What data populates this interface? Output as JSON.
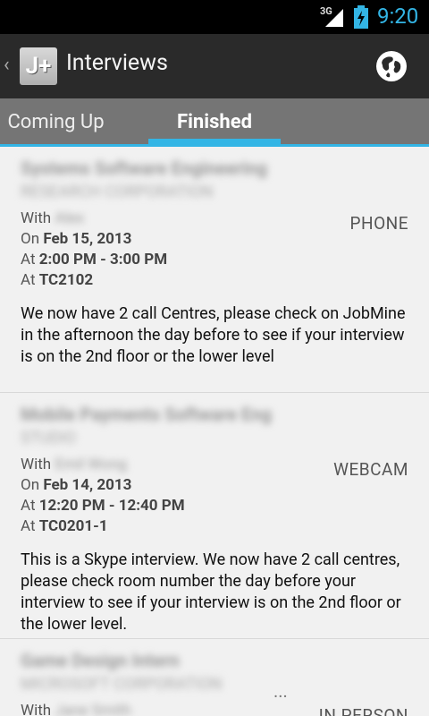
{
  "status_bar": {
    "network": "3G",
    "time": "9:20"
  },
  "action_bar": {
    "logo_text": "J+",
    "title": "Interviews"
  },
  "tabs": [
    {
      "label": "Coming Up",
      "selected": false
    },
    {
      "label": "Finished",
      "selected": true
    }
  ],
  "interviews": [
    {
      "job_title": "Systems Software Engineering",
      "company": "RESEARCH CORPORATION",
      "with_label": "With",
      "with_name": "Alex",
      "on_label": "On",
      "date": "Feb 15, 2013",
      "at_label": "At",
      "time": "2:00 PM - 3:00 PM",
      "at2_label": "At",
      "room": "TC2102",
      "type": "PHONE",
      "note": "We now have 2 call Centres, please check on JobMine in the afternoon the day before to see if your interview is on the 2nd floor or the lower level"
    },
    {
      "job_title": "Mobile Payments Software Eng",
      "company": "STUDIO",
      "with_label": "With",
      "with_name": "Emil Wong",
      "on_label": "On",
      "date": "Feb 14, 2013",
      "at_label": "At",
      "time": "12:20 PM - 12:40 PM",
      "at2_label": "At",
      "room": "TC0201-1",
      "type": "WEBCAM",
      "note": "This is a Skype interview. We now have 2 call centres, please check room number the day before your interview to see if your interview is on the 2nd floor or the lower level."
    },
    {
      "job_title": "Game Design Intern",
      "company": "MICROSOFT CORPORATION",
      "with_label": "With",
      "with_name": "Jane Smith",
      "type": "IN PERSON"
    }
  ],
  "ellipsis": "..."
}
